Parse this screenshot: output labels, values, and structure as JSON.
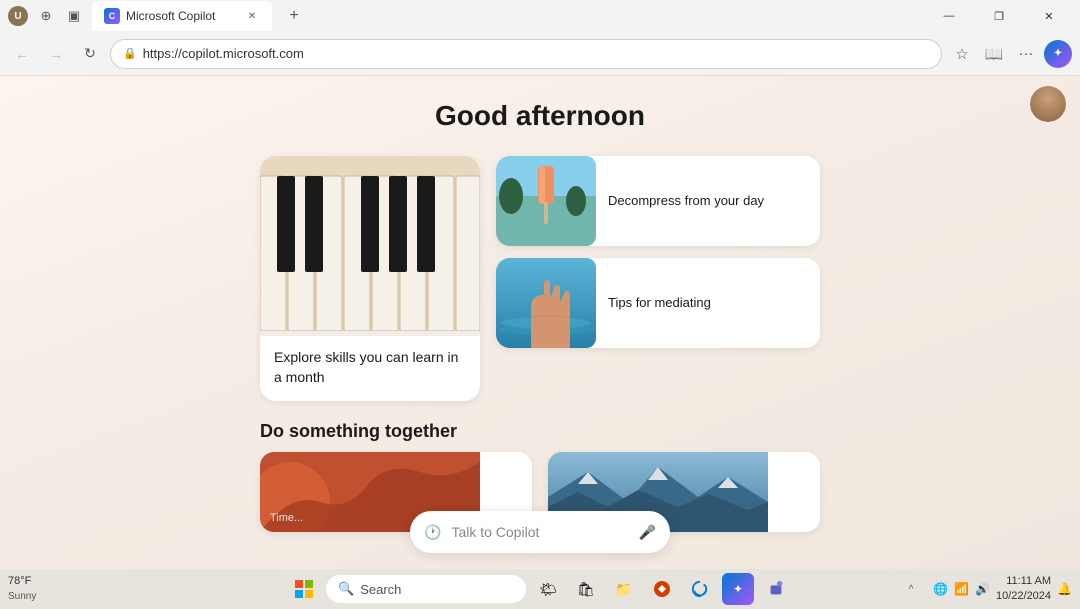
{
  "titlebar": {
    "title": "Microsoft Copilot",
    "favicon_label": "C",
    "close": "✕",
    "minimize": "—",
    "maximize": "❐",
    "new_tab": "+"
  },
  "addressbar": {
    "url": "https://copilot.microsoft.com",
    "back": "←",
    "forward": "→",
    "refresh": "↻"
  },
  "main": {
    "greeting": "Good afternoon",
    "card_piano": {
      "label": "Explore skills you can learn in a month"
    },
    "card_popsicle": {
      "label": "Decompress from your day"
    },
    "card_water": {
      "label": "Tips for mediating"
    },
    "section_together": "Do something together",
    "bottom_card_left_label": "Time...",
    "chat_placeholder": "Talk to Copilot"
  },
  "taskbar": {
    "weather_temp": "78°F",
    "weather_condition": "Sunny",
    "search_placeholder": "Search",
    "time": "11:11 AM",
    "date": "10/22/2024",
    "start_icon": "⊞",
    "search_icon": "🔍"
  },
  "profile": {
    "initials": "U"
  }
}
